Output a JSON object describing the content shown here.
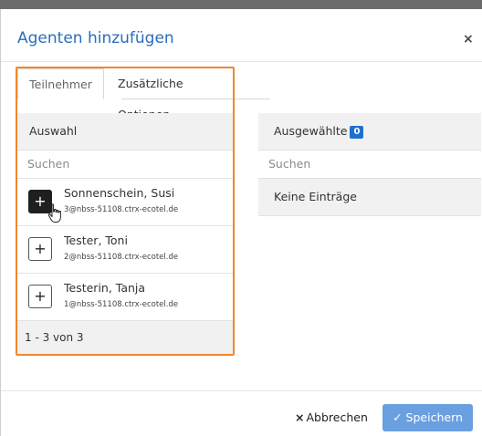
{
  "dialog": {
    "title": "Agenten hinzufügen",
    "close_icon": "×"
  },
  "tabs": [
    {
      "label": "Teilnehmer",
      "active": true
    },
    {
      "label": "Zusätzliche Optionen",
      "active": false
    }
  ],
  "left_panel": {
    "header": "Auswahl",
    "search_placeholder": "Suchen",
    "items": [
      {
        "name": "Sonnenschein, Susi",
        "email": "3@nbss-51108.ctrx-ecotel.de",
        "add_icon": "+"
      },
      {
        "name": "Tester, Toni",
        "email": "2@nbss-51108.ctrx-ecotel.de",
        "add_icon": "+"
      },
      {
        "name": "Testerin, Tanja",
        "email": "1@nbss-51108.ctrx-ecotel.de",
        "add_icon": "+"
      }
    ],
    "pagination": "1 - 3 von 3"
  },
  "right_panel": {
    "header": "Ausgewählte",
    "count": "0",
    "search_placeholder": "Suchen",
    "empty_text": "Keine Einträge"
  },
  "footer": {
    "cancel_icon": "×",
    "cancel_label": "Abbrechen",
    "save_icon": "✓",
    "save_label": "Speichern"
  },
  "colors": {
    "title": "#2a6ebb",
    "highlight": "#f0882e",
    "badge": "#1f6fd1",
    "save_button": "#6a9fe0"
  }
}
